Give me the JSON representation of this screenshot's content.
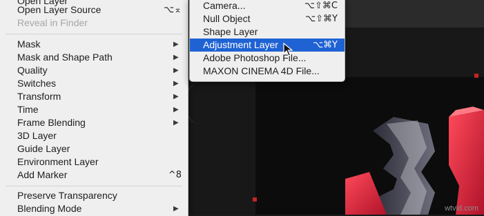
{
  "menu": {
    "items": [
      {
        "label": "Open Layer",
        "shortcut": "",
        "submenu": false,
        "disabled": false
      },
      {
        "label": "Open Layer Source",
        "shortcut": "⌥⌅",
        "submenu": false,
        "disabled": false
      },
      {
        "label": "Reveal in Finder",
        "shortcut": "",
        "submenu": false,
        "disabled": true
      },
      {
        "label": "Mask",
        "shortcut": "",
        "submenu": true,
        "disabled": false
      },
      {
        "label": "Mask and Shape Path",
        "shortcut": "",
        "submenu": true,
        "disabled": false
      },
      {
        "label": "Quality",
        "shortcut": "",
        "submenu": true,
        "disabled": false
      },
      {
        "label": "Switches",
        "shortcut": "",
        "submenu": true,
        "disabled": false
      },
      {
        "label": "Transform",
        "shortcut": "",
        "submenu": true,
        "disabled": false
      },
      {
        "label": "Time",
        "shortcut": "",
        "submenu": true,
        "disabled": false
      },
      {
        "label": "Frame Blending",
        "shortcut": "",
        "submenu": true,
        "disabled": false
      },
      {
        "label": "3D Layer",
        "shortcut": "",
        "submenu": false,
        "disabled": false
      },
      {
        "label": "Guide Layer",
        "shortcut": "",
        "submenu": false,
        "disabled": false
      },
      {
        "label": "Environment Layer",
        "shortcut": "",
        "submenu": false,
        "disabled": false
      },
      {
        "label": "Add Marker",
        "shortcut": "^8",
        "submenu": false,
        "disabled": false
      },
      {
        "label": "Preserve Transparency",
        "shortcut": "",
        "submenu": false,
        "disabled": false
      },
      {
        "label": "Blending Mode",
        "shortcut": "",
        "submenu": true,
        "disabled": false
      }
    ]
  },
  "submenu": {
    "items": [
      {
        "label": "Camera...",
        "shortcut": "⌥⇧⌘C",
        "highlighted": false
      },
      {
        "label": "Null Object",
        "shortcut": "⌥⇧⌘Y",
        "highlighted": false
      },
      {
        "label": "Shape Layer",
        "shortcut": "",
        "highlighted": false
      },
      {
        "label": "Adjustment Layer",
        "shortcut": "⌥⌘Y",
        "highlighted": true
      },
      {
        "label": "Adobe Photoshop File...",
        "shortcut": "",
        "highlighted": false
      },
      {
        "label": "MAXON CINEMA 4D File...",
        "shortcut": "",
        "highlighted": false
      }
    ]
  },
  "icons": {
    "submenu_arrow": "triangle-right-icon",
    "cursor": "arrow-cursor-icon"
  },
  "colors": {
    "menu_bg": "#efefef",
    "highlight": "#1f62d3",
    "handle": "#c62323"
  },
  "watermark": "wtvid.com"
}
